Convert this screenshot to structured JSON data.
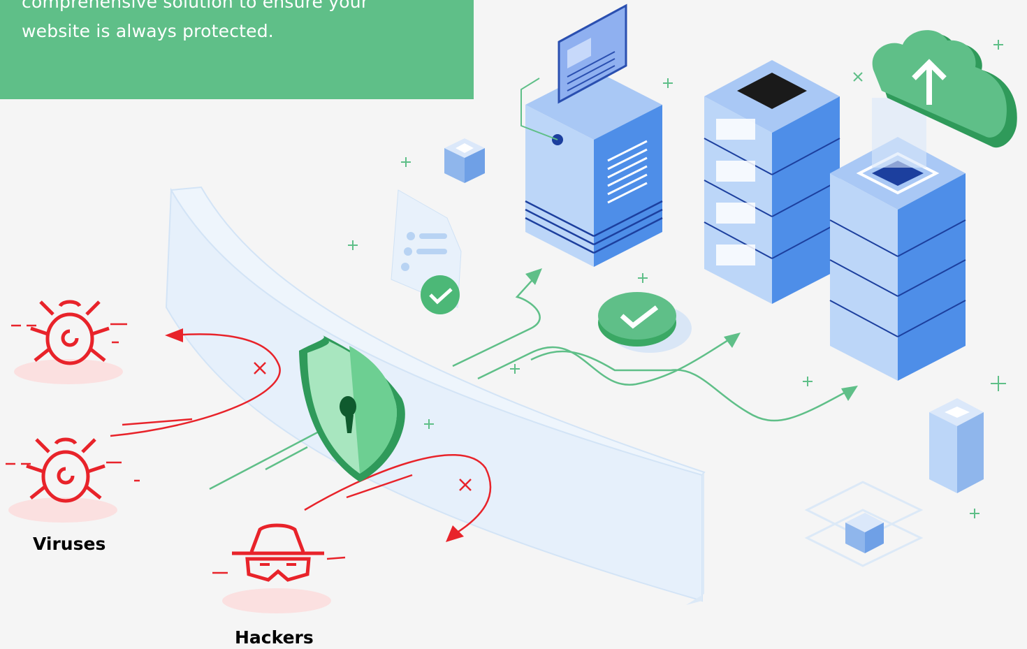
{
  "banner": {
    "text_line1": "comprehensive solution to ensure your",
    "text_line2": "website is always protected."
  },
  "threats": {
    "viruses_label": "Viruses",
    "hackers_label": "Hackers"
  },
  "colors": {
    "banner_green": "#5fbf88",
    "threat_red": "#e8232a",
    "flow_green": "#5fbf88",
    "server_blue": "#4e8ee8",
    "shield_green": "#3aa864",
    "background": "#f5f5f5"
  },
  "icons": [
    "virus-bug-icon",
    "hacker-mask-icon",
    "shield-lock-icon",
    "server-icon",
    "cloud-upload-icon",
    "checkmark-badge-icon",
    "document-icon"
  ]
}
